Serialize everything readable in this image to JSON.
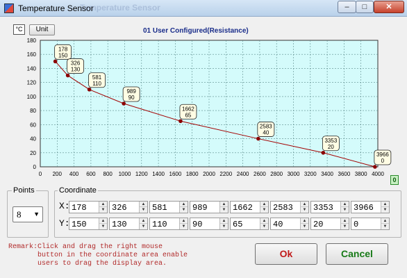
{
  "window": {
    "title": "Temperature Sensor",
    "ghost_title": "Temperature Sensor",
    "minimize": "–",
    "maximize": "□",
    "close": "✕"
  },
  "toolbar": {
    "unit_symbol": "°C",
    "unit_button": "Unit"
  },
  "chart_data": {
    "type": "line",
    "title": "01 User Configured(Resistance)",
    "xlim": [
      0,
      4000
    ],
    "ylim": [
      0,
      180
    ],
    "x_ticks": [
      0,
      200,
      400,
      600,
      800,
      1000,
      1200,
      1400,
      1600,
      1800,
      2000,
      2200,
      2400,
      2600,
      2800,
      3000,
      3200,
      3400,
      3600,
      3800,
      4000
    ],
    "y_ticks": [
      0,
      20,
      40,
      60,
      80,
      100,
      120,
      140,
      160,
      180
    ],
    "grid": true,
    "colors": {
      "line": "#a30000",
      "point": "#8a0000",
      "label_bg": "#fffde4",
      "plot_bg": "#d4fbfb",
      "grid": "#5c8c8c",
      "title": "#1a2d8a"
    },
    "series": [
      {
        "x": [
          178,
          326,
          581,
          989,
          1662,
          2583,
          3353,
          3966
        ],
        "values": [
          150,
          130,
          110,
          90,
          65,
          40,
          20,
          0
        ]
      }
    ],
    "data_labels": [
      [
        "178",
        "150"
      ],
      [
        "326",
        "130"
      ],
      [
        "581",
        "110"
      ],
      [
        "989",
        "90"
      ],
      [
        "1662",
        "65"
      ],
      [
        "2583",
        "40"
      ],
      [
        "3353",
        "20"
      ],
      [
        "3966",
        "0"
      ]
    ],
    "corner_indicator": "0"
  },
  "points": {
    "label": "Points",
    "selected": "8",
    "arrow": "▼"
  },
  "coordinate": {
    "label": "Coordinate",
    "x_label": "X:",
    "y_label": "Y:",
    "x_values": [
      "178",
      "326",
      "581",
      "989",
      "1662",
      "2583",
      "3353",
      "3966"
    ],
    "y_values": [
      "150",
      "130",
      "110",
      "90",
      "65",
      "40",
      "20",
      "0"
    ],
    "spin_up": "▲",
    "spin_down": "▼"
  },
  "remark": "Remark:Click and drag the right mouse\n       button in the coordinate area enable\n       users to drag the display area.",
  "buttons": {
    "ok": "Ok",
    "cancel": "Cancel"
  }
}
